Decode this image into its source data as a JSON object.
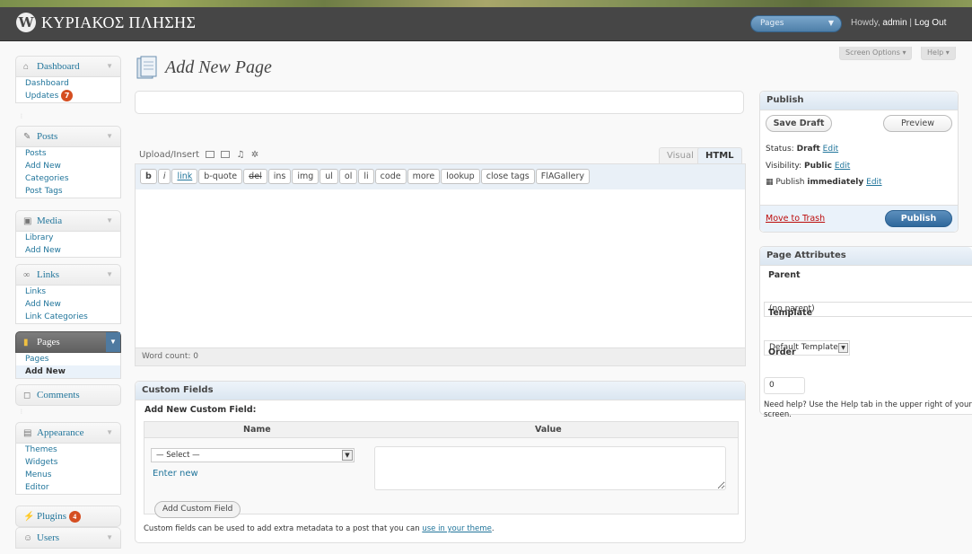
{
  "header": {
    "site_title": "ΚΥΡΙΑΚΟΣ ΠΛΗΣΗΣ",
    "favorites_selected": "Pages",
    "howdy_prefix": "Howdy,",
    "username": "admin",
    "divider": "|",
    "logout": "Log Out"
  },
  "screen_options": {
    "screen_options_label": "Screen Options ▾",
    "help_label": "Help ▾"
  },
  "sidebar": {
    "dashboard": {
      "label": "Dashboard",
      "items": [
        "Dashboard",
        "Updates"
      ],
      "updates_badge": "7"
    },
    "posts": {
      "label": "Posts",
      "items": [
        "Posts",
        "Add New",
        "Categories",
        "Post Tags"
      ]
    },
    "media": {
      "label": "Media",
      "items": [
        "Library",
        "Add New"
      ]
    },
    "links": {
      "label": "Links",
      "items": [
        "Links",
        "Add New",
        "Link Categories"
      ]
    },
    "pages": {
      "label": "Pages",
      "items": [
        "Pages",
        "Add New"
      ]
    },
    "comments": {
      "label": "Comments"
    },
    "appearance": {
      "label": "Appearance",
      "items": [
        "Themes",
        "Widgets",
        "Menus",
        "Editor"
      ]
    },
    "plugins": {
      "label": "Plugins",
      "badge": "4"
    },
    "users": {
      "label": "Users"
    }
  },
  "main": {
    "page_title": "Add New Page",
    "post_title_value": "",
    "upload_insert": "Upload/Insert",
    "tabs": {
      "visual": "Visual",
      "html": "HTML"
    },
    "quicktags": [
      "b",
      "i",
      "link",
      "b-quote",
      "del",
      "ins",
      "img",
      "ul",
      "ol",
      "li",
      "code",
      "more",
      "lookup",
      "close tags",
      "FlAGallery"
    ],
    "word_count": "Word count: 0"
  },
  "custom_fields": {
    "title": "Custom Fields",
    "subtitle": "Add New Custom Field:",
    "col_name": "Name",
    "col_value": "Value",
    "select_value": "— Select —",
    "enter_new": "Enter new",
    "add_button": "Add Custom Field",
    "note_text": "Custom fields can be used to add extra metadata to a post that you can",
    "note_link": "use in your theme",
    "note_end": "."
  },
  "publish": {
    "title": "Publish",
    "save_draft": "Save Draft",
    "preview": "Preview",
    "status_label": "Status:",
    "status_value": "Draft",
    "visibility_label": "Visibility:",
    "visibility_value": "Public",
    "publish_label": "Publish",
    "publish_value": "immediately",
    "edit": "Edit",
    "move_to_trash": "Move to Trash",
    "publish_button": "Publish"
  },
  "page_attributes": {
    "title": "Page Attributes",
    "parent_label": "Parent",
    "parent_value": "(no parent)",
    "template_label": "Template",
    "template_value": "Default Template",
    "order_label": "Order",
    "order_value": "0",
    "help_text": "Need help? Use the Help tab in the upper right of your screen."
  },
  "colors": {
    "link": "#21759b",
    "header_bg": "#464646",
    "primary_button": "#2f689c",
    "badge": "#d54e21",
    "trash": "#bc0b0b"
  }
}
